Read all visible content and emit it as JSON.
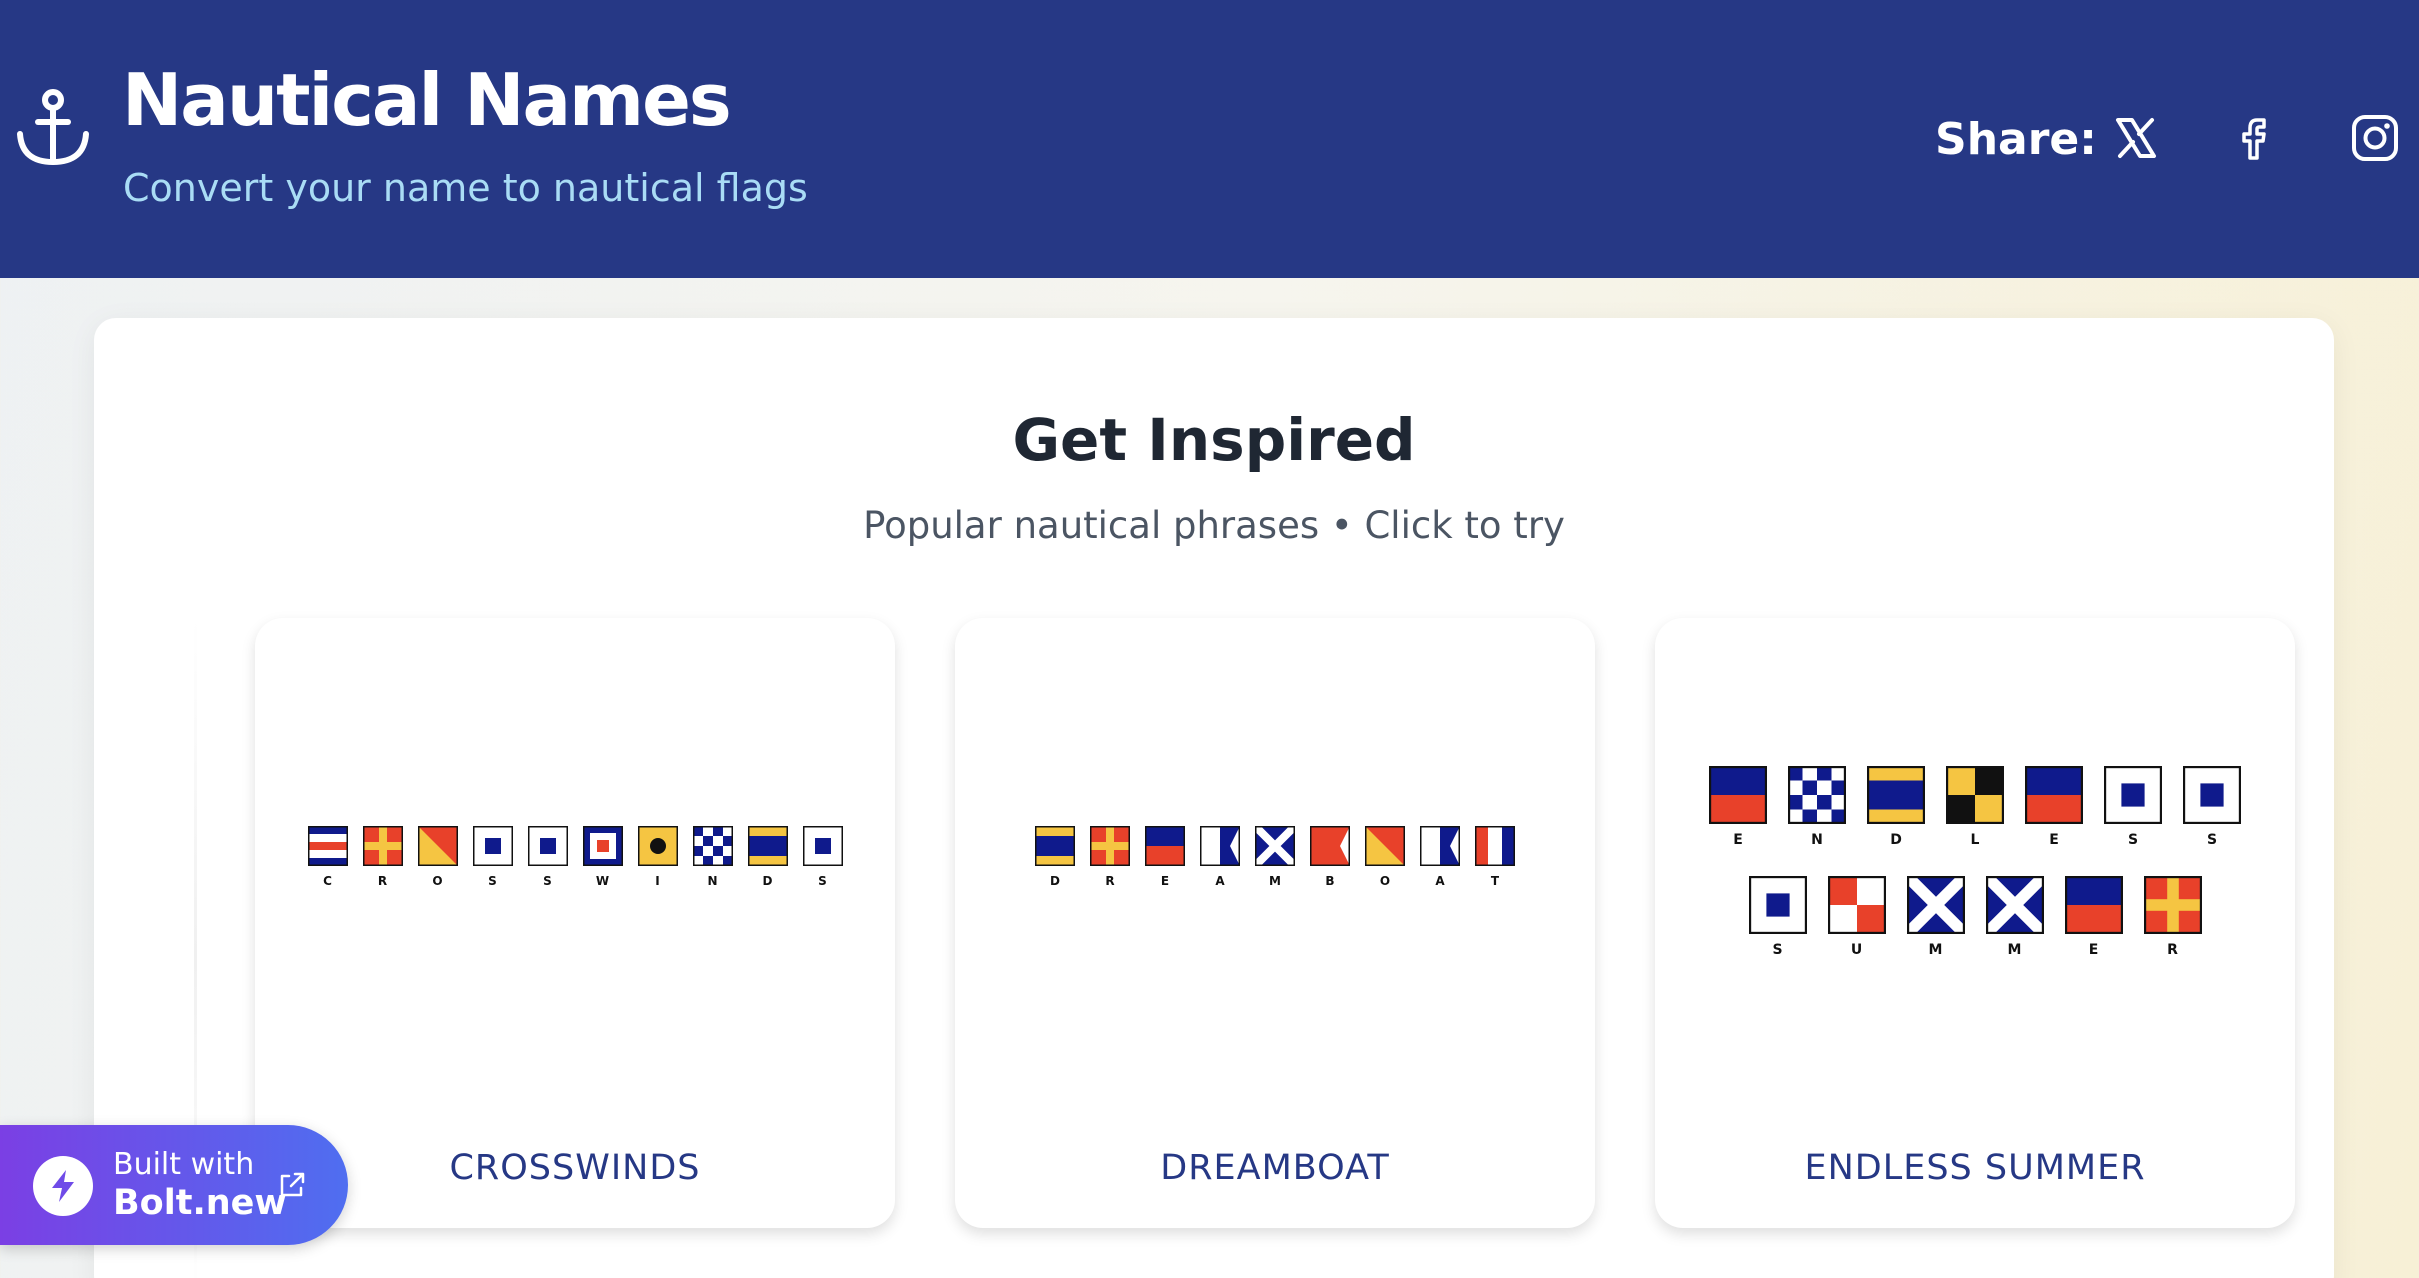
{
  "header": {
    "title": "Nautical Names",
    "subtitle": "Convert your name to nautical flags",
    "share_label": "Share:",
    "social_icons": [
      "x-icon",
      "facebook-icon",
      "instagram-icon"
    ],
    "logo_icon": "anchor-icon"
  },
  "main": {
    "section_title": "Get Inspired",
    "section_subtitle": "Popular nautical phrases • Click to try",
    "cards": [
      {
        "label": "CROSSWINDS",
        "rows": [
          [
            "C",
            "R",
            "O",
            "S",
            "S",
            "W",
            "I",
            "N",
            "D",
            "S"
          ]
        ]
      },
      {
        "label": "DREAMBOAT",
        "rows": [
          [
            "D",
            "R",
            "E",
            "A",
            "M",
            "B",
            "O",
            "A",
            "T"
          ]
        ]
      },
      {
        "label": "ENDLESS SUMMER",
        "rows": [
          [
            "E",
            "N",
            "D",
            "L",
            "E",
            "S",
            "S"
          ],
          [
            "S",
            "U",
            "M",
            "M",
            "E",
            "R"
          ]
        ]
      }
    ]
  },
  "badge": {
    "top_text": "Built with",
    "name": "Bolt.new",
    "icon": "bolt-icon",
    "link_icon": "external-link-icon"
  },
  "colors": {
    "header_bg": "#263885",
    "subtitle": "#a9dcf5",
    "flag_blue": "#0f1a8c",
    "flag_red": "#e8412a",
    "flag_yellow": "#f5c542"
  }
}
